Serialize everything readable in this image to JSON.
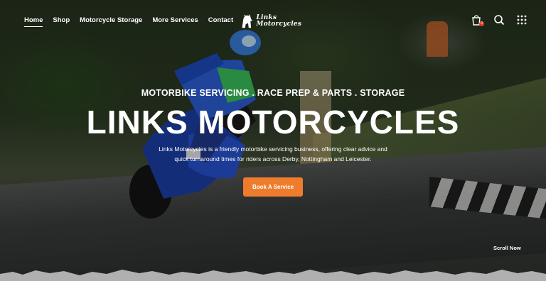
{
  "nav": {
    "items": [
      {
        "label": "Home",
        "active": true
      },
      {
        "label": "Shop"
      },
      {
        "label": "Motorcycle Storage"
      },
      {
        "label": "More Services"
      },
      {
        "label": "Contact"
      }
    ]
  },
  "logo": {
    "line1": "Links",
    "line2": "Motorcycles"
  },
  "header_icons": {
    "cart": "shopping-bag-icon",
    "cart_count": "0",
    "search": "search-icon",
    "menu": "grid-menu-icon"
  },
  "hero": {
    "eyebrow": "MOTORBIKE SERVICING . RACE PREP & PARTS . STORAGE",
    "title": "LINKS MOTORCYCLES",
    "description": "Links Motorcycles is a friendly motorbike servicing business, offering clear advice and quick turnaround times for riders across Derby, Nottingham and Leicester.",
    "cta_label": "Book A Service",
    "scroll_label": "Scroll Now"
  },
  "colors": {
    "accent": "#ee7c2c",
    "text": "#ffffff",
    "badge": "#e23a2a"
  }
}
